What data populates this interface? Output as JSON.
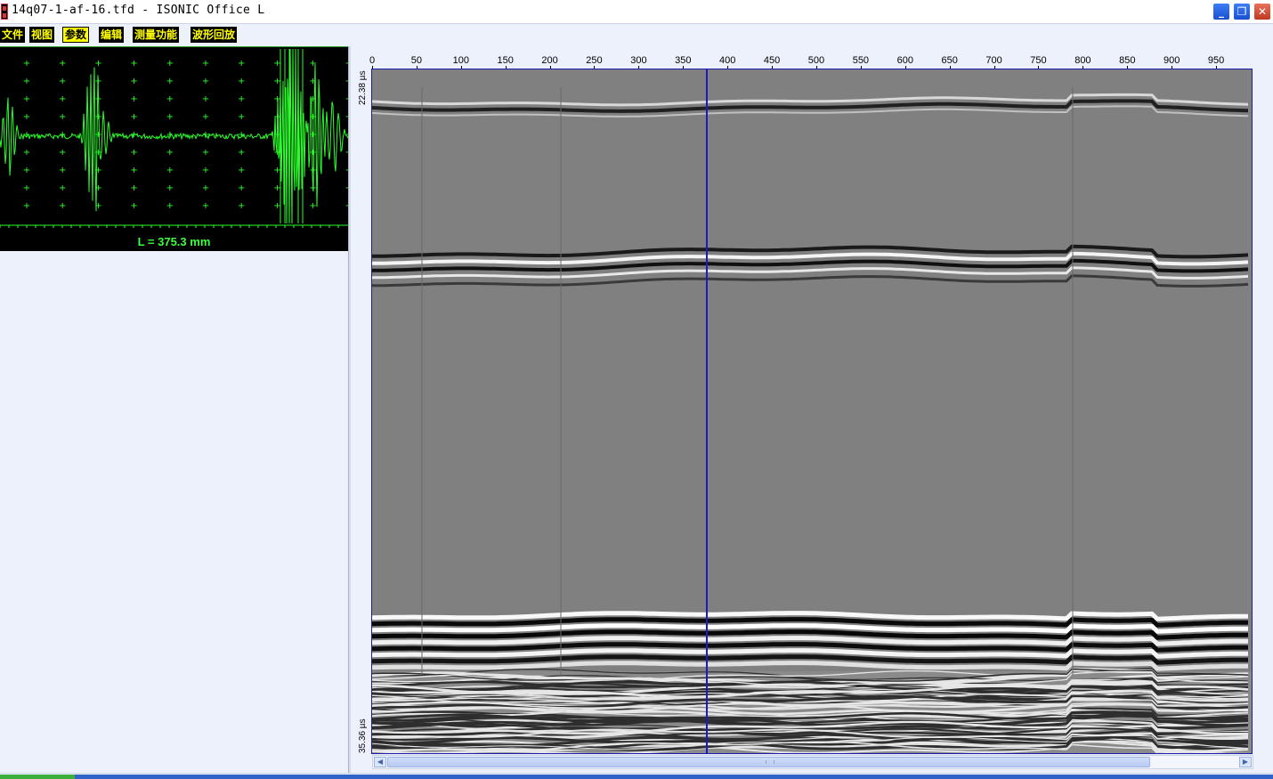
{
  "window": {
    "title": "14q07-1-af-16.tfd - ISONIC Office L",
    "controls": {
      "minimize": "_",
      "maximize": "❐",
      "close": "✕"
    }
  },
  "menu": {
    "items": [
      {
        "label": "文件",
        "active": false
      },
      {
        "label": "视图",
        "active": false
      },
      {
        "label": "参数",
        "active": true
      },
      {
        "label": "编辑",
        "active": false
      },
      {
        "label": "测量功能",
        "active": false
      },
      {
        "label": "波形回放",
        "active": false
      }
    ]
  },
  "ascan": {
    "readout": "L = 375.3 mm",
    "trace_color": "#2aff2a",
    "grid_color": "#2aff2a",
    "background": "#000000"
  },
  "bscan": {
    "x_ticks": [
      "0",
      "50",
      "100",
      "150",
      "200",
      "250",
      "300",
      "350",
      "400",
      "450",
      "500",
      "550",
      "600",
      "650",
      "700",
      "750",
      "800",
      "850",
      "900",
      "950"
    ],
    "x_range": [
      0,
      990
    ],
    "y_top_label": "22.38 µs",
    "y_bottom_label": "35.36 µs",
    "cursor_position": 375.3,
    "frame_color": "#1a1ab0",
    "cursor_color": "#1b1bb8"
  },
  "scrollbar": {
    "left_arrow": "◀",
    "right_arrow": "▶"
  }
}
